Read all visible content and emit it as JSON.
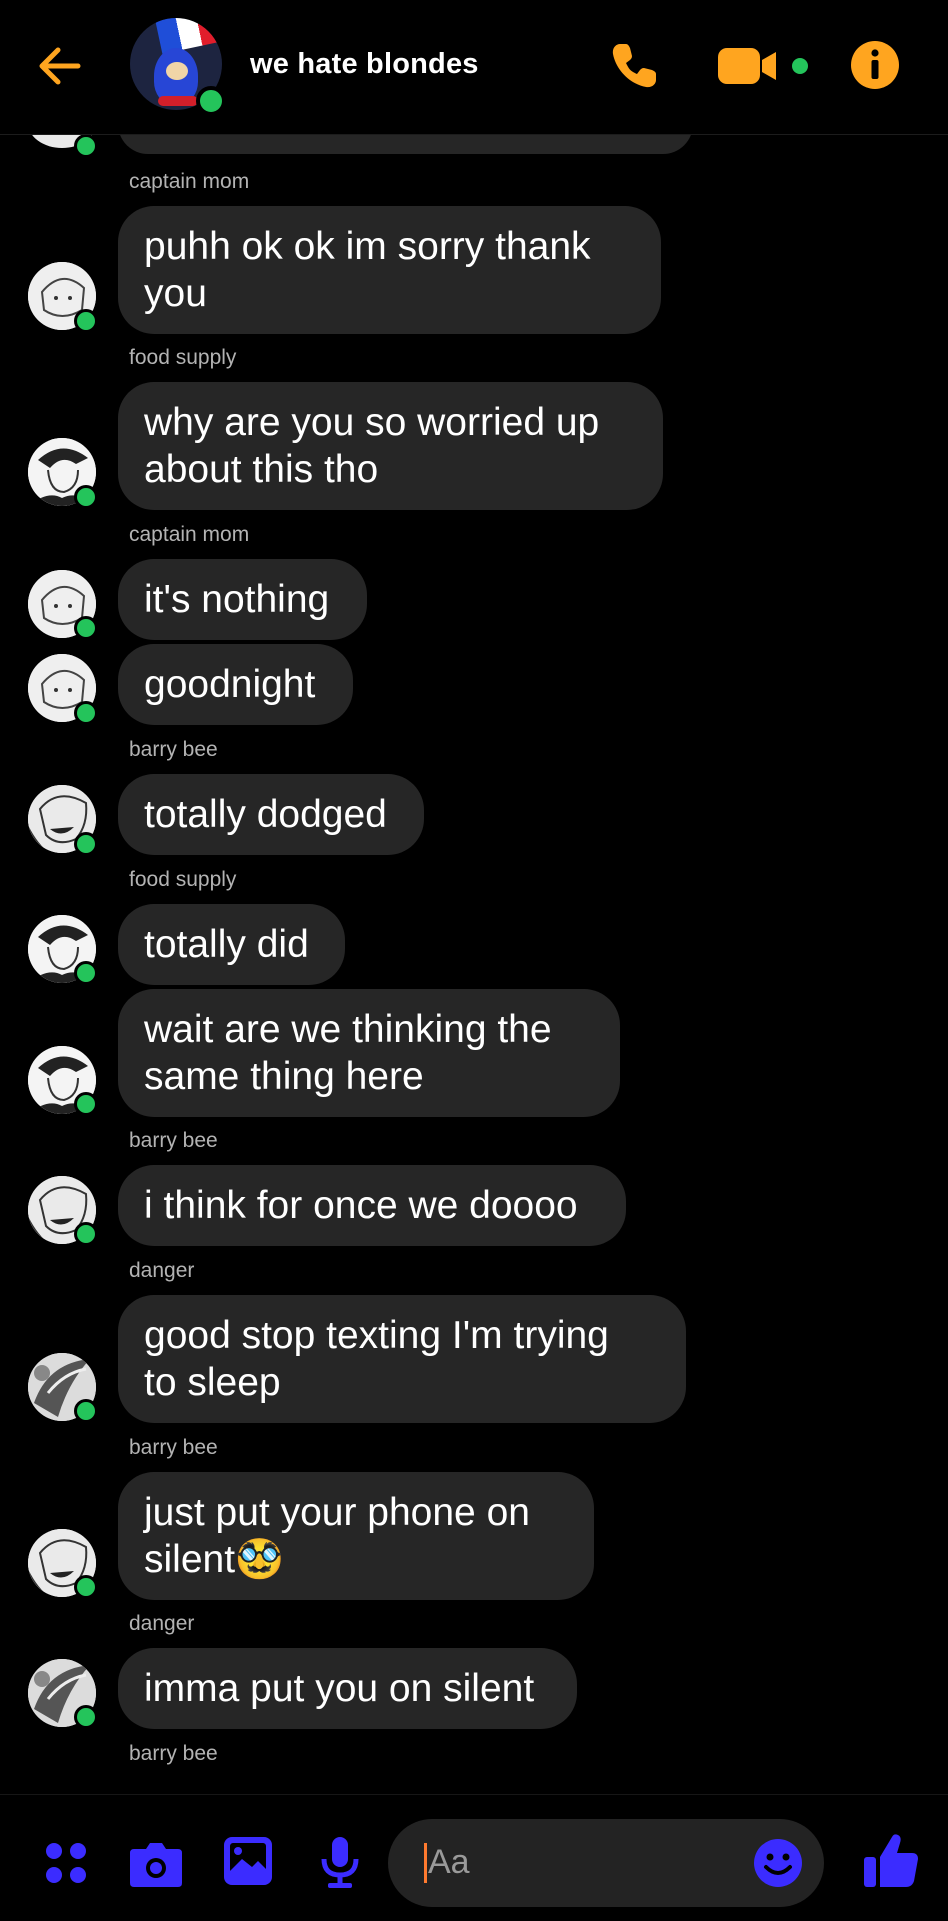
{
  "header": {
    "title": "we hate blondes",
    "icons": [
      "back-arrow-icon",
      "phone-icon",
      "video-camera-icon",
      "info-icon"
    ]
  },
  "colors": {
    "accent": "#ffa51f",
    "bubble": "#262626",
    "online": "#24c45b",
    "composer_icons": "#3b2cff"
  },
  "messages": [
    {
      "sender": "captain mom",
      "text": "puhh ok ok im sorry thank\nyou"
    },
    {
      "sender": "food supply",
      "text": "why are you so worried up\nabout this tho"
    },
    {
      "sender": "captain mom",
      "text": "it's nothing"
    },
    {
      "sender": "",
      "text": "goodnight"
    },
    {
      "sender": "barry bee",
      "text": "totally dodged"
    },
    {
      "sender": "food supply",
      "text": "totally did"
    },
    {
      "sender": "",
      "text": "wait are we thinking the\nsame thing here"
    },
    {
      "sender": "barry bee",
      "text": "i think for once we doooo"
    },
    {
      "sender": "danger",
      "text": "good stop texting I'm trying\nto sleep"
    },
    {
      "sender": "barry bee",
      "text": "just put your phone on\nsilent🥸"
    },
    {
      "sender": "danger",
      "text": "imma put you on silent"
    },
    {
      "sender": "barry bee",
      "text": ""
    }
  ],
  "composer": {
    "placeholder": "Aa",
    "icons": [
      "menu-dots-icon",
      "camera-icon",
      "gallery-icon",
      "microphone-icon",
      "emoji-icon",
      "thumbs-up-icon"
    ]
  }
}
